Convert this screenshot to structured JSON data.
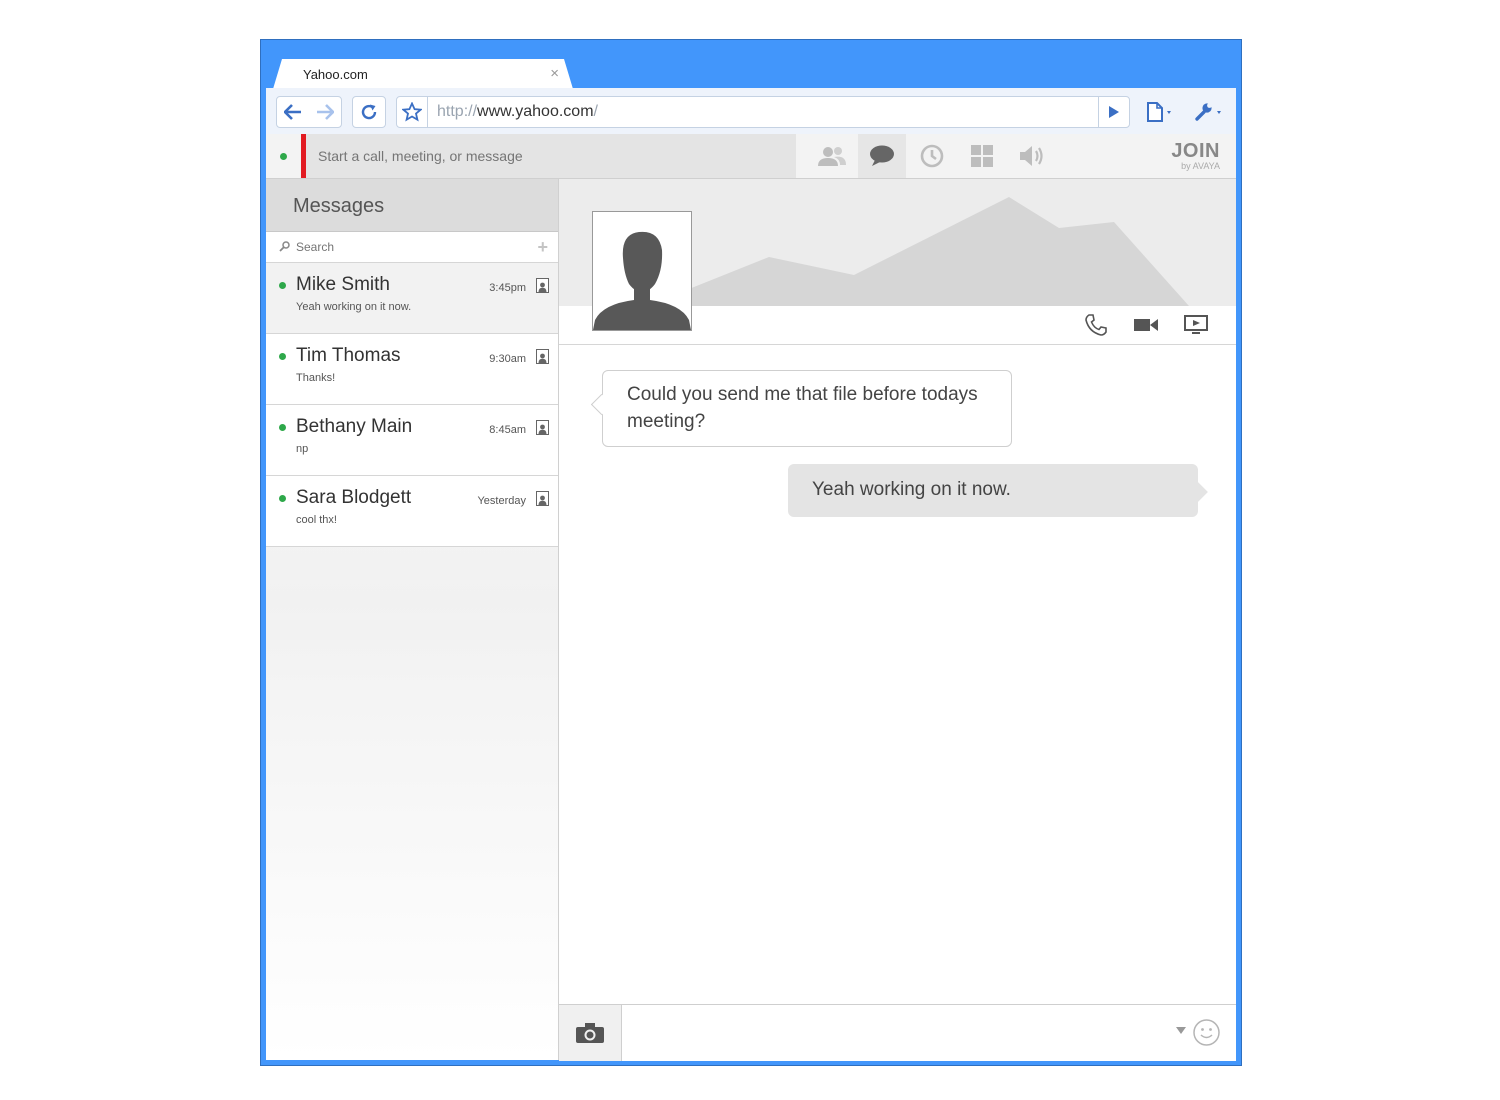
{
  "browser": {
    "tab_title": "Yahoo.com",
    "tab_close": "×",
    "url_protocol": "http://",
    "url_host": "www.yahoo.com",
    "url_path": "/",
    "accent_color": "#4296fb"
  },
  "appbar": {
    "call_placeholder": "Start a call, meeting, or message",
    "icons": [
      "contacts-icon",
      "chat-icon",
      "history-icon",
      "apps-icon",
      "audio-icon"
    ],
    "brand_main": "JOIN",
    "brand_sub": "by AVAYA",
    "presence_color": "#2ea84a"
  },
  "sidebar": {
    "title": "Messages",
    "search_placeholder": "Search",
    "conversations": [
      {
        "name": "Mike Smith",
        "preview": "Yeah working on it now.",
        "time": "3:45pm"
      },
      {
        "name": "Tim Thomas",
        "preview": "Thanks!",
        "time": "9:30am"
      },
      {
        "name": "Bethany Main",
        "preview": "np",
        "time": "8:45am"
      },
      {
        "name": "Sara Blodgett",
        "preview": "cool thx!",
        "time": "Yesterday"
      }
    ]
  },
  "chat": {
    "messages": [
      {
        "direction": "incoming",
        "text": "Could you send me that file before todays meeting?"
      },
      {
        "direction": "outgoing",
        "text": "Yeah working on it now."
      }
    ],
    "composer_placeholder": ""
  }
}
